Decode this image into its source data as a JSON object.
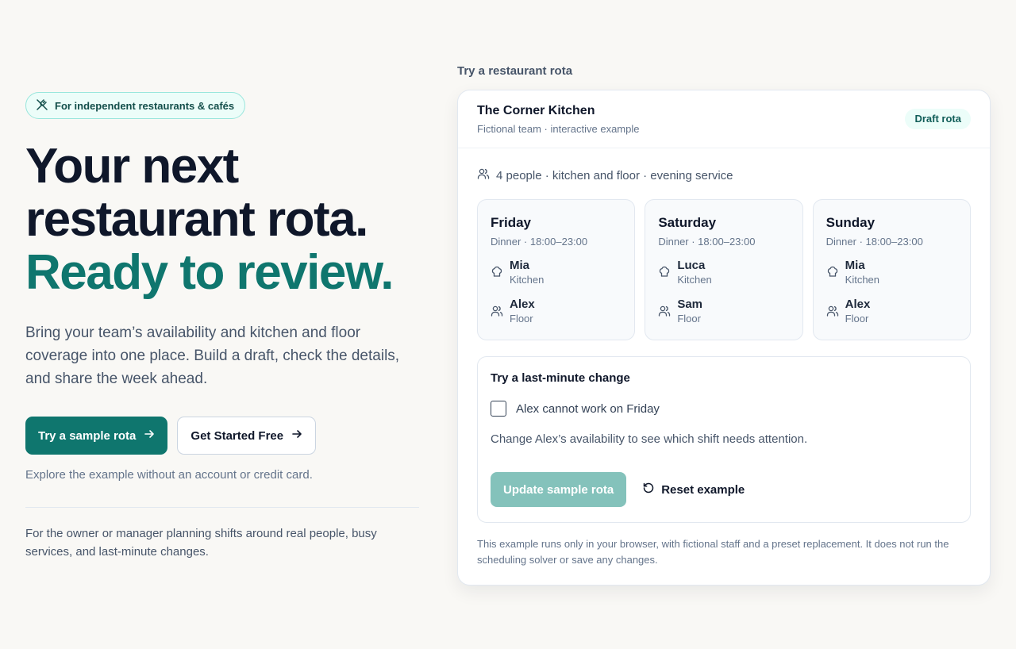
{
  "hero": {
    "badge": "For independent restaurants & cafés",
    "headline_line1": "Your next",
    "headline_line2": "restaurant rota.",
    "headline_accent": "Ready to review.",
    "lede": "Bring your team’s availability and kitchen and floor coverage into one place. Build a draft, check the details, and share the week ahead.",
    "primary_cta": "Try a sample rota",
    "secondary_cta": "Get Started Free",
    "note": "Explore the example without an account or credit card.",
    "audience": "For the owner or manager planning shifts around real people, busy services, and last-minute changes."
  },
  "demo": {
    "label": "Try a restaurant rota",
    "restaurant": "The Corner Kitchen",
    "subtitle": "Fictional team · interactive example",
    "status": "Draft rota",
    "team_summary": "4 people · kitchen and floor · evening service",
    "days": [
      {
        "name": "Friday",
        "time": "Dinner · 18:00–23:00",
        "staff": [
          {
            "name": "Mia",
            "role": "Kitchen",
            "icon": "chef-hat-icon"
          },
          {
            "name": "Alex",
            "role": "Floor",
            "icon": "users-icon"
          }
        ]
      },
      {
        "name": "Saturday",
        "time": "Dinner · 18:00–23:00",
        "staff": [
          {
            "name": "Luca",
            "role": "Kitchen",
            "icon": "chef-hat-icon"
          },
          {
            "name": "Sam",
            "role": "Floor",
            "icon": "users-icon"
          }
        ]
      },
      {
        "name": "Sunday",
        "time": "Dinner · 18:00–23:00",
        "staff": [
          {
            "name": "Mia",
            "role": "Kitchen",
            "icon": "chef-hat-icon"
          },
          {
            "name": "Alex",
            "role": "Floor",
            "icon": "users-icon"
          }
        ]
      }
    ],
    "change": {
      "title": "Try a last-minute change",
      "checkbox_label": "Alex cannot work on Friday",
      "checked": false,
      "help": "Change Alex’s availability to see which shift needs attention.",
      "update_button": "Update sample rota",
      "reset_button": "Reset example"
    },
    "disclaimer": "This example runs only in your browser, with fictional staff and a preset replacement. It does not run the scheduling solver or save any changes."
  },
  "colors": {
    "background": "#f9f8f5",
    "accent": "#0f766e",
    "text": "#0f172a",
    "muted": "#64748b"
  }
}
